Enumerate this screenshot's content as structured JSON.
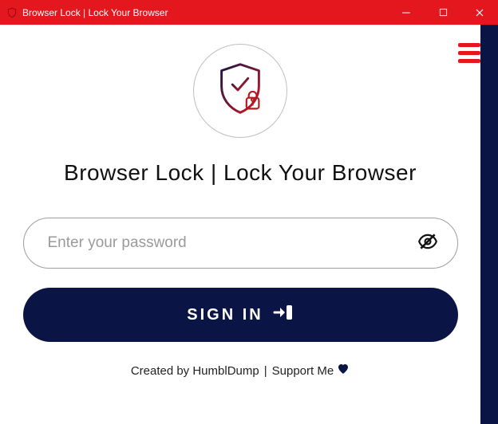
{
  "window": {
    "title": "Browser Lock | Lock Your Browser"
  },
  "heading": "Browser Lock | Lock Your Browser",
  "password": {
    "placeholder": "Enter your password",
    "value": ""
  },
  "signin_label": "SIGN IN",
  "footer": {
    "created_by": "Created by HumblDump",
    "separator": "|",
    "support": "Support Me"
  },
  "icons": {
    "app": "shield-lock",
    "minimize": "minimize",
    "maximize": "maximize",
    "close": "close",
    "hamburger": "hamburger",
    "shield_lock": "shield-lock",
    "eye_off": "eye-off",
    "signin_arrow": "signin-arrow",
    "heart": "heart"
  },
  "colors": {
    "accent_red": "#e4171f",
    "dark_navy": "#0b1545"
  }
}
